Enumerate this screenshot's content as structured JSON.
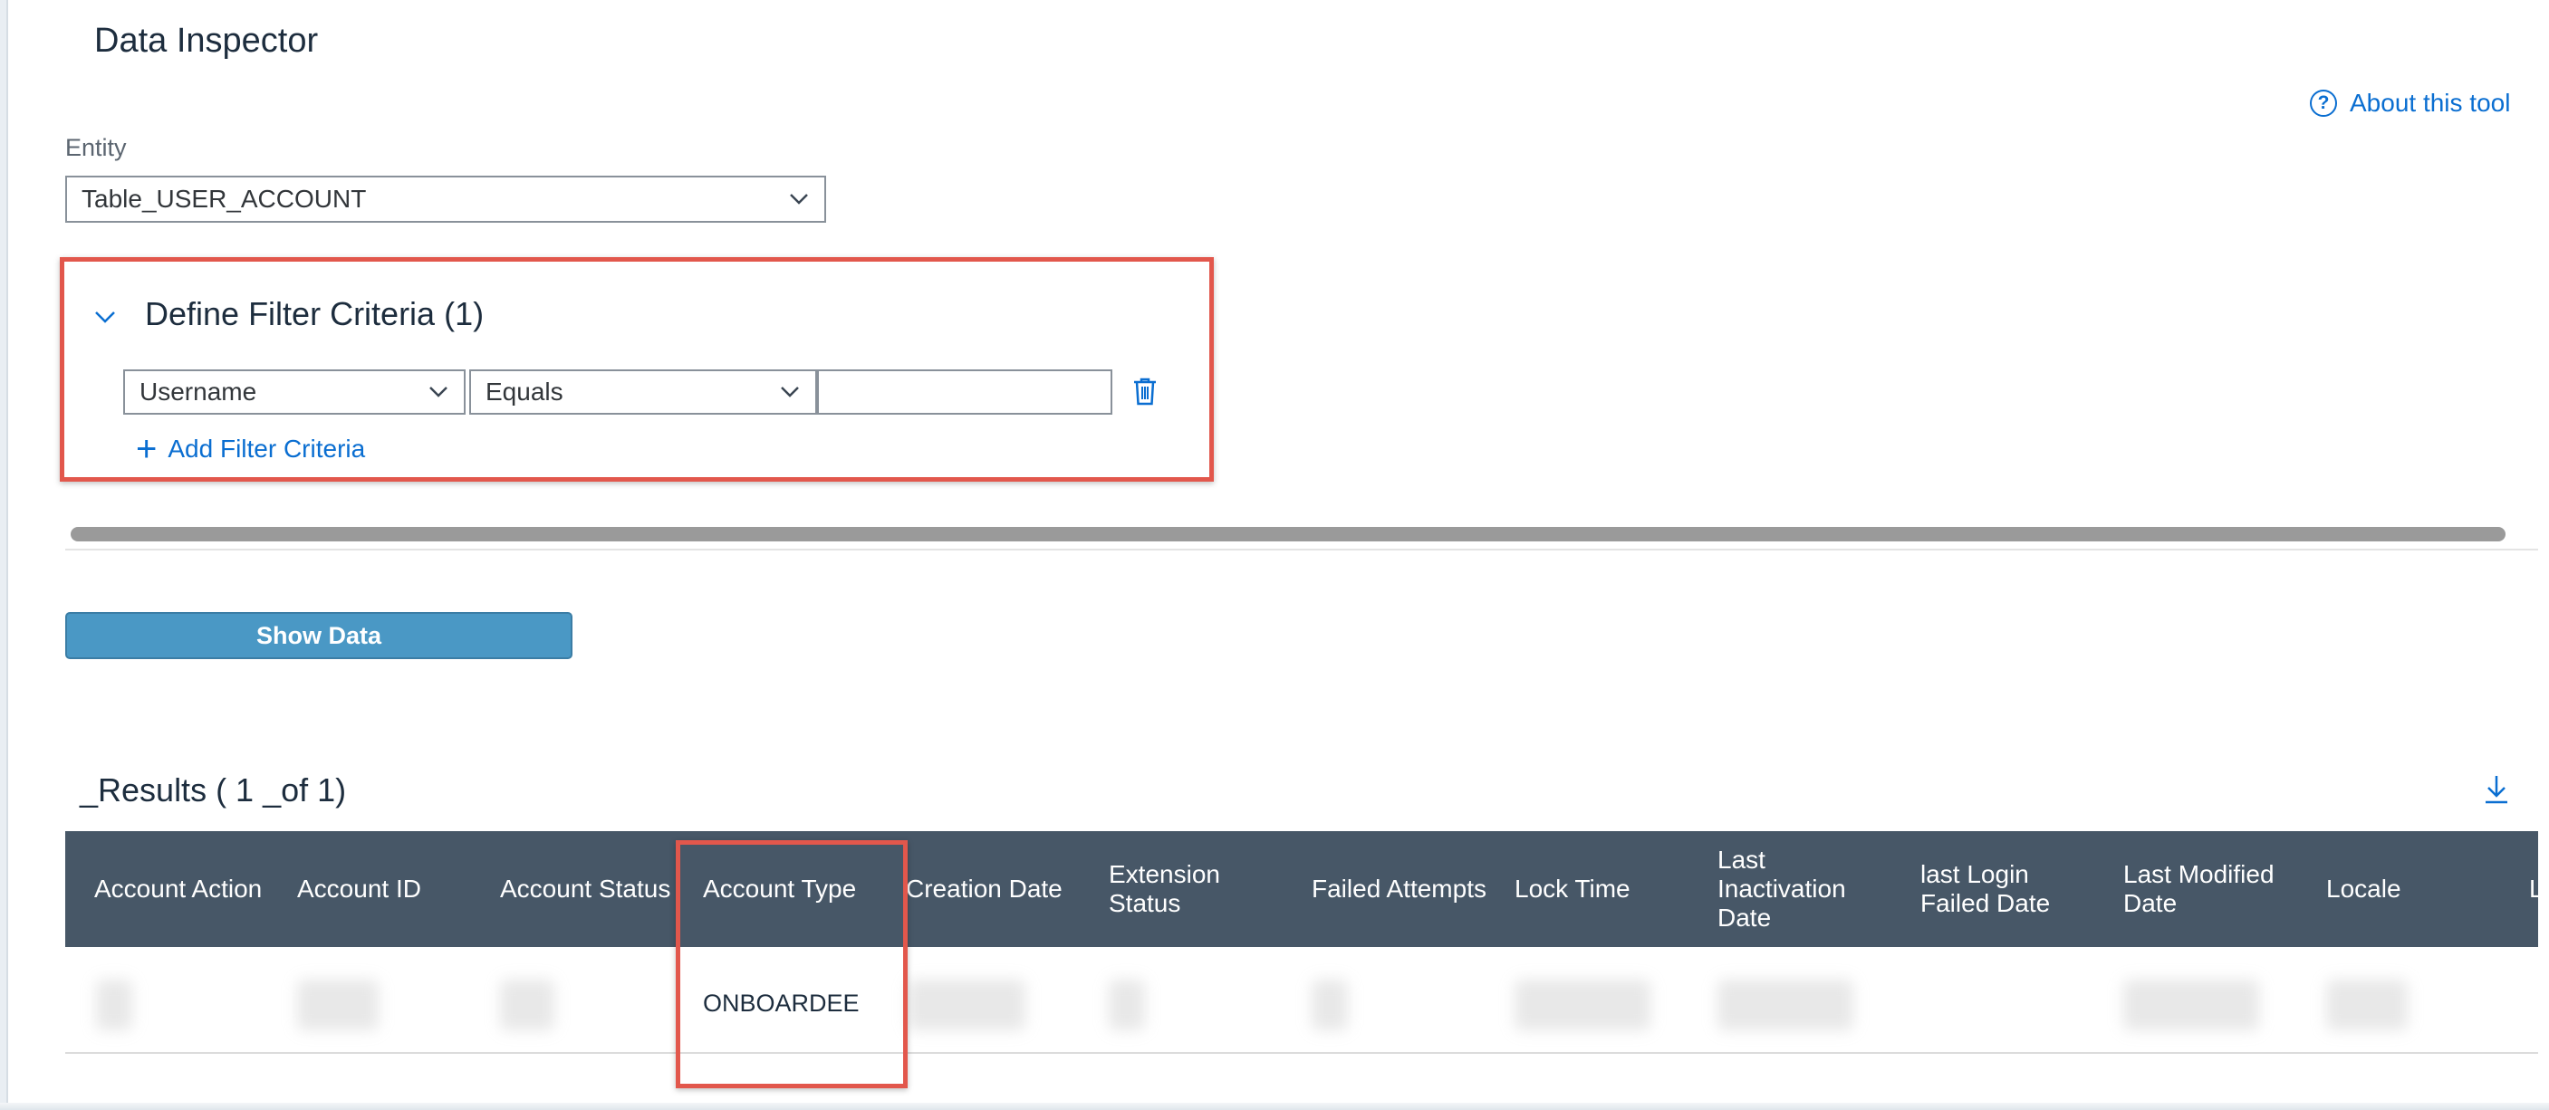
{
  "page": {
    "title": "Data Inspector"
  },
  "about": {
    "label": "About this tool",
    "icon": "help-circle-icon"
  },
  "entity": {
    "label": "Entity",
    "selected": "Table_USER_ACCOUNT"
  },
  "filter": {
    "title": "Define Filter Criteria (1)",
    "criteria": [
      {
        "field": "Username",
        "operator": "Equals",
        "value": ""
      }
    ],
    "add_label": "Add Filter Criteria"
  },
  "actions": {
    "show_data_label": "Show Data"
  },
  "results": {
    "title": "_Results ( 1 _of 1)",
    "columns": [
      "Account Action",
      "Account ID",
      "Account Status",
      "Account Type",
      "Creation Date",
      "Extension\nStatus",
      "Failed Attempts",
      "Lock Time",
      "Last\nInactivation\nDate",
      "last Login\nFailed Date",
      "Last Modified\nDate",
      "Locale",
      "L"
    ],
    "rows": [
      {
        "account_type": "ONBOARDEE"
      }
    ]
  },
  "colors": {
    "accent": "#0a6ed1",
    "header_bg": "#475767",
    "button_bg": "#4a98c5",
    "highlight": "#e2574c"
  }
}
